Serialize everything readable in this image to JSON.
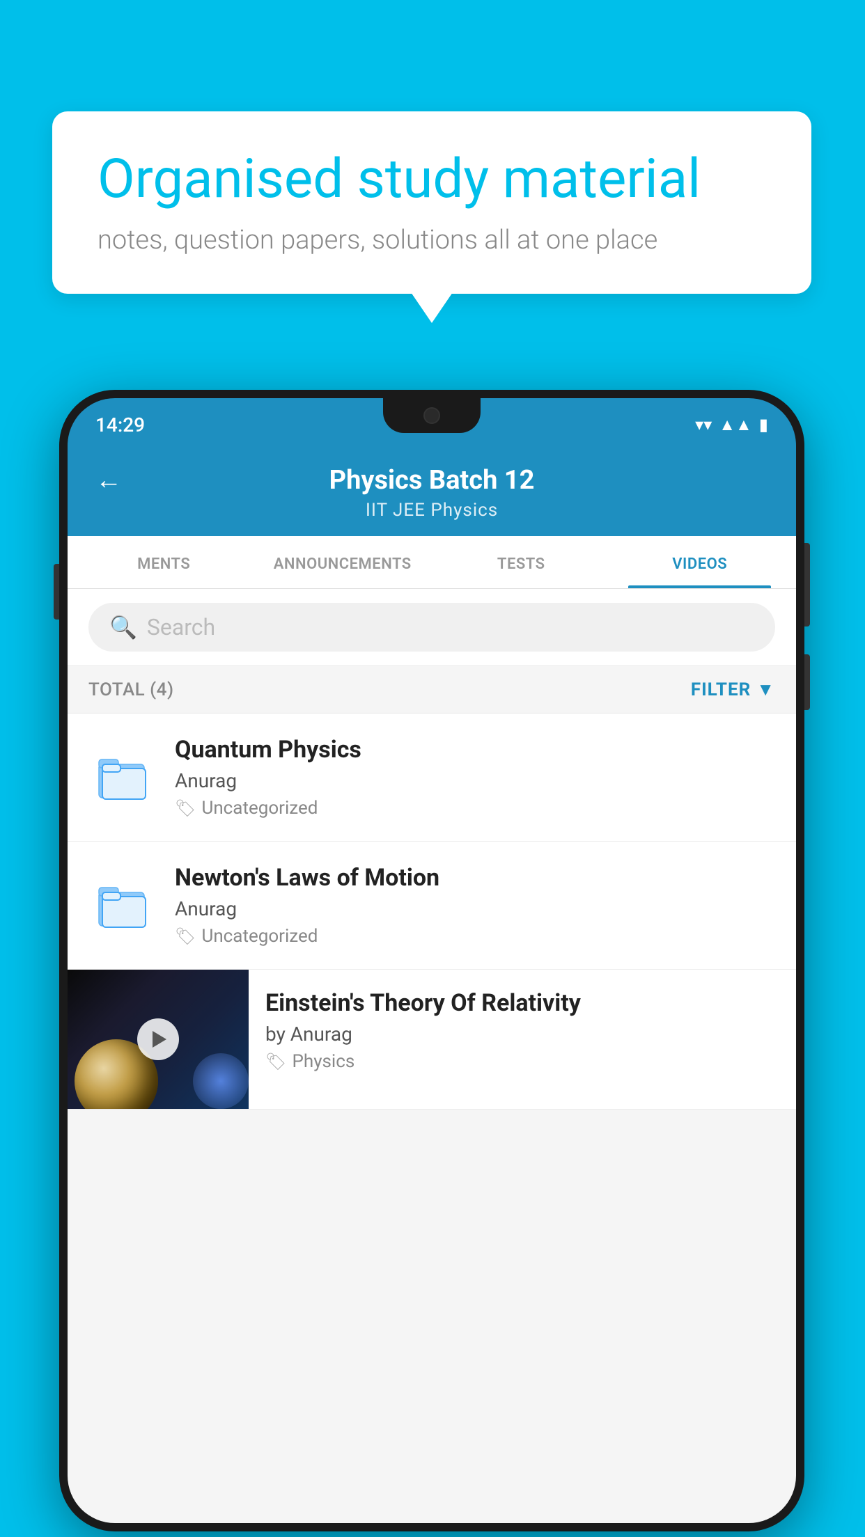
{
  "background_color": "#00BFEA",
  "speech_bubble": {
    "heading": "Organised study material",
    "subtext": "notes, question papers, solutions all at one place"
  },
  "phone": {
    "status_bar": {
      "time": "14:29"
    },
    "header": {
      "back_label": "←",
      "title": "Physics Batch 12",
      "subtitle_tags": "IIT JEE    Physics"
    },
    "tabs": [
      {
        "label": "MENTS",
        "active": false
      },
      {
        "label": "ANNOUNCEMENTS",
        "active": false
      },
      {
        "label": "TESTS",
        "active": false
      },
      {
        "label": "VIDEOS",
        "active": true
      }
    ],
    "search": {
      "placeholder": "Search"
    },
    "total_label": "TOTAL (4)",
    "filter_label": "FILTER",
    "videos": [
      {
        "title": "Quantum Physics",
        "author": "Anurag",
        "tag": "Uncategorized",
        "type": "folder"
      },
      {
        "title": "Newton's Laws of Motion",
        "author": "Anurag",
        "tag": "Uncategorized",
        "type": "folder"
      },
      {
        "title": "Einstein's Theory Of Relativity",
        "author": "by Anurag",
        "tag": "Physics",
        "type": "thumbnail"
      }
    ]
  }
}
